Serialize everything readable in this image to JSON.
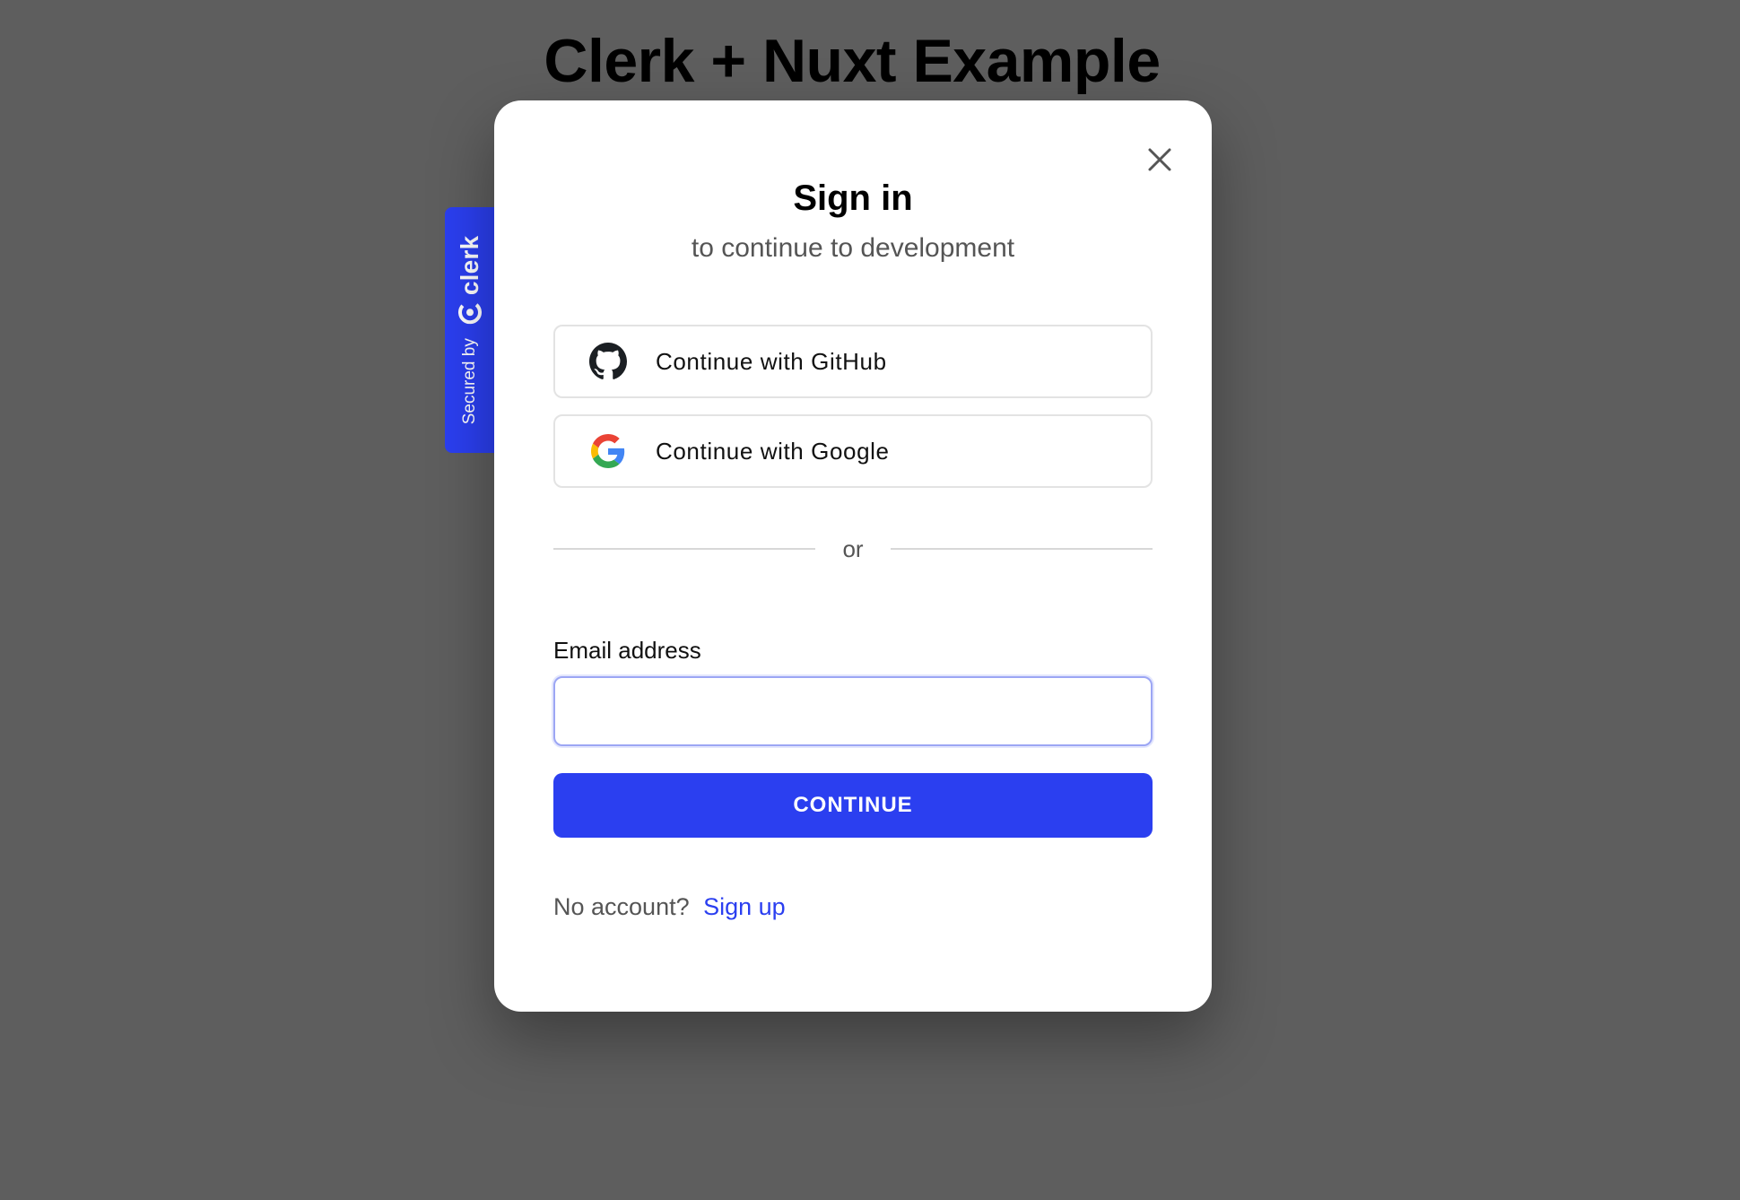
{
  "page": {
    "title": "Clerk + Nuxt Example"
  },
  "badge": {
    "secured_by": "Secured by",
    "brand": "clerk"
  },
  "modal": {
    "title": "Sign in",
    "subtitle": "to continue to development",
    "close_icon": "close-icon",
    "social": [
      {
        "label": "Continue with GitHub",
        "icon": "github-icon"
      },
      {
        "label": "Continue with Google",
        "icon": "google-icon"
      }
    ],
    "divider_text": "or",
    "email": {
      "label": "Email address",
      "value": "",
      "placeholder": ""
    },
    "continue_label": "CONTINUE",
    "footer": {
      "prompt": "No account?",
      "link_label": "Sign up"
    }
  },
  "colors": {
    "background": "#5e5e5e",
    "accent": "#2b3ff0",
    "modal_bg": "#ffffff"
  }
}
